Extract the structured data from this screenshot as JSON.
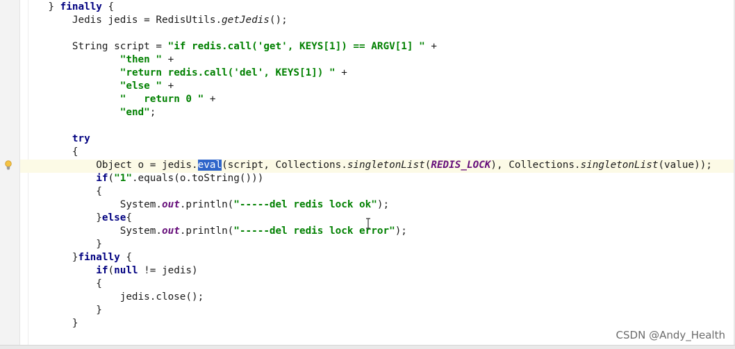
{
  "editor": {
    "lines": [
      {
        "t": [
          {
            "c": "",
            "v": "    } "
          },
          {
            "c": "kw",
            "v": "finally"
          },
          {
            "c": "",
            "v": " {"
          }
        ]
      },
      {
        "t": [
          {
            "c": "",
            "v": "        Jedis jedis = RedisUtils."
          },
          {
            "c": "ital",
            "v": "getJedis"
          },
          {
            "c": "",
            "v": "();"
          }
        ]
      },
      {
        "t": [
          {
            "c": "",
            "v": ""
          }
        ]
      },
      {
        "t": [
          {
            "c": "",
            "v": "        String script = "
          },
          {
            "c": "str",
            "v": "\"if redis.call('get', KEYS[1]) == ARGV[1] \""
          },
          {
            "c": "",
            "v": " +"
          }
        ]
      },
      {
        "t": [
          {
            "c": "",
            "v": "                "
          },
          {
            "c": "str",
            "v": "\"then \""
          },
          {
            "c": "",
            "v": " +"
          }
        ]
      },
      {
        "t": [
          {
            "c": "",
            "v": "                "
          },
          {
            "c": "str",
            "v": "\"return redis.call('del', KEYS[1]) \""
          },
          {
            "c": "",
            "v": " +"
          }
        ]
      },
      {
        "t": [
          {
            "c": "",
            "v": "                "
          },
          {
            "c": "str",
            "v": "\"else \""
          },
          {
            "c": "",
            "v": " +"
          }
        ]
      },
      {
        "t": [
          {
            "c": "",
            "v": "                "
          },
          {
            "c": "str",
            "v": "\"   return 0 \""
          },
          {
            "c": "",
            "v": " +"
          }
        ]
      },
      {
        "t": [
          {
            "c": "",
            "v": "                "
          },
          {
            "c": "str",
            "v": "\"end\""
          },
          {
            "c": "",
            "v": ";"
          }
        ]
      },
      {
        "t": [
          {
            "c": "",
            "v": ""
          }
        ]
      },
      {
        "t": [
          {
            "c": "",
            "v": "        "
          },
          {
            "c": "kw",
            "v": "try"
          }
        ]
      },
      {
        "t": [
          {
            "c": "",
            "v": "        {"
          }
        ]
      },
      {
        "t": [
          {
            "c": "",
            "v": "            Object o = jedis."
          },
          {
            "c": "sel",
            "v": "eval"
          },
          {
            "c": "",
            "v": "(script, Collections."
          },
          {
            "c": "ital",
            "v": "singletonList"
          },
          {
            "c": "",
            "v": "("
          },
          {
            "c": "field",
            "v": "REDIS_LOCK"
          },
          {
            "c": "",
            "v": "), Collections."
          },
          {
            "c": "ital",
            "v": "singletonList"
          },
          {
            "c": "",
            "v": "(value));"
          }
        ]
      },
      {
        "t": [
          {
            "c": "",
            "v": "            "
          },
          {
            "c": "kw",
            "v": "if"
          },
          {
            "c": "",
            "v": "("
          },
          {
            "c": "str",
            "v": "\"1\""
          },
          {
            "c": "",
            "v": ".equals(o.toString()))"
          }
        ]
      },
      {
        "t": [
          {
            "c": "",
            "v": "            {"
          }
        ]
      },
      {
        "t": [
          {
            "c": "",
            "v": "                System."
          },
          {
            "c": "field",
            "v": "out"
          },
          {
            "c": "",
            "v": ".println("
          },
          {
            "c": "str",
            "v": "\"-----del redis lock ok\""
          },
          {
            "c": "",
            "v": ");"
          }
        ]
      },
      {
        "t": [
          {
            "c": "",
            "v": "            }"
          },
          {
            "c": "kw",
            "v": "else"
          },
          {
            "c": "",
            "v": "{"
          }
        ]
      },
      {
        "t": [
          {
            "c": "",
            "v": "                System."
          },
          {
            "c": "field",
            "v": "out"
          },
          {
            "c": "",
            "v": ".println("
          },
          {
            "c": "str",
            "v": "\"-----del redis lock error\""
          },
          {
            "c": "",
            "v": ");"
          }
        ]
      },
      {
        "t": [
          {
            "c": "",
            "v": "            }"
          }
        ]
      },
      {
        "t": [
          {
            "c": "",
            "v": "        }"
          },
          {
            "c": "kw",
            "v": "finally"
          },
          {
            "c": "",
            "v": " {"
          }
        ]
      },
      {
        "t": [
          {
            "c": "",
            "v": "            "
          },
          {
            "c": "kw",
            "v": "if"
          },
          {
            "c": "",
            "v": "("
          },
          {
            "c": "kw",
            "v": "null"
          },
          {
            "c": "",
            "v": " != jedis)"
          }
        ]
      },
      {
        "t": [
          {
            "c": "",
            "v": "            {"
          }
        ]
      },
      {
        "t": [
          {
            "c": "",
            "v": "                jedis.close();"
          }
        ]
      },
      {
        "t": [
          {
            "c": "",
            "v": "            }"
          }
        ]
      },
      {
        "t": [
          {
            "c": "",
            "v": "        }"
          }
        ]
      }
    ]
  },
  "gutter": {
    "intention_icon": "lightbulb-icon"
  },
  "cursor_icon": "text-cursor-icon",
  "watermark": {
    "text": "CSDN @Andy_Health"
  },
  "colors": {
    "keyword": "#000080",
    "string": "#008000",
    "field": "#660e7a",
    "selection": "#2f65ca",
    "caret_row": "#fcfae6"
  }
}
